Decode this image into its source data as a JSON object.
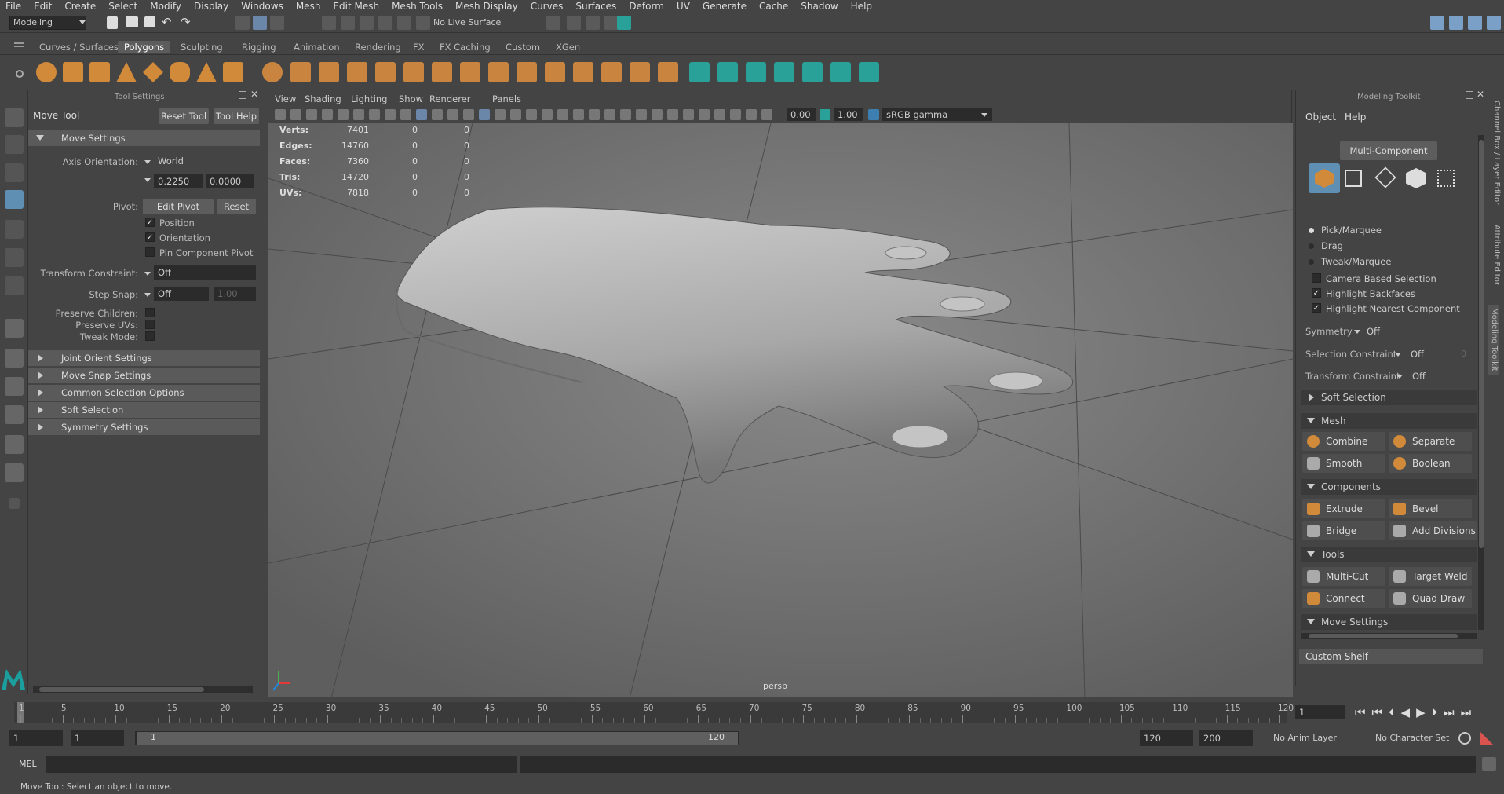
{
  "menubar": [
    "File",
    "Edit",
    "Create",
    "Select",
    "Modify",
    "Display",
    "Windows",
    "Mesh",
    "Edit Mesh",
    "Mesh Tools",
    "Mesh Display",
    "Curves",
    "Surfaces",
    "Deform",
    "UV",
    "Generate",
    "Cache",
    "Shadow",
    "Help"
  ],
  "status": {
    "menuset": "Modeling",
    "live_surface": "No Live Surface"
  },
  "shelf_tabs": [
    "Curves / Surfaces",
    "Polygons",
    "Sculpting",
    "Rigging",
    "Animation",
    "Rendering",
    "FX",
    "FX Caching",
    "Custom",
    "XGen"
  ],
  "shelf_active": "Polygons",
  "tool_settings": {
    "panel_title": "Tool Settings",
    "tool_name": "Move Tool",
    "reset_tool": "Reset Tool",
    "tool_help": "Tool Help",
    "section": "Move Settings",
    "axis_orientation_label": "Axis Orientation:",
    "axis_orientation": "World",
    "axis_val1": "0.2250",
    "axis_val2": "0.0000",
    "pivot_label": "Pivot:",
    "edit_pivot": "Edit Pivot",
    "reset": "Reset",
    "position": "Position",
    "orientation": "Orientation",
    "pin_component_pivot": "Pin Component Pivot",
    "transform_constraint_label": "Transform Constraint:",
    "transform_constraint": "Off",
    "step_snap_label": "Step Snap:",
    "step_snap": "Off",
    "step_snap_val": "1.00",
    "preserve_children": "Preserve Children:",
    "preserve_uvs": "Preserve UVs:",
    "tweak_mode": "Tweak Mode:",
    "collapsed_sections": [
      "Joint Orient Settings",
      "Move Snap Settings",
      "Common Selection Options",
      "Soft Selection",
      "Symmetry Settings"
    ]
  },
  "viewport": {
    "menus": [
      "View",
      "Shading",
      "Lighting",
      "Show",
      "Renderer",
      "Panels"
    ],
    "exposure": "0.00",
    "gamma": "1.00",
    "colorspace": "sRGB gamma",
    "camera": "persp",
    "hud": [
      {
        "label": "Verts:",
        "a": "7401",
        "b": "0",
        "c": "0"
      },
      {
        "label": "Edges:",
        "a": "14760",
        "b": "0",
        "c": "0"
      },
      {
        "label": "Faces:",
        "a": "7360",
        "b": "0",
        "c": "0"
      },
      {
        "label": "Tris:",
        "a": "14720",
        "b": "0",
        "c": "0"
      },
      {
        "label": "UVs:",
        "a": "7818",
        "b": "0",
        "c": "0"
      }
    ]
  },
  "modeling_toolkit": {
    "title": "Modeling Toolkit",
    "menus": [
      "Object",
      "Help"
    ],
    "mode": "Multi-Component",
    "selection_modes": [
      "Pick/Marquee",
      "Drag",
      "Tweak/Marquee"
    ],
    "options": [
      {
        "label": "Camera Based Selection",
        "checked": ""
      },
      {
        "label": "Highlight Backfaces",
        "checked": "✓"
      },
      {
        "label": "Highlight Nearest Component",
        "checked": "✓"
      }
    ],
    "symmetry_label": "Symmetry",
    "symmetry": "Off",
    "selection_constraint_label": "Selection Constraint",
    "selection_constraint": "Off",
    "selection_constraint_val": "0",
    "transform_constraint_label": "Transform Constraint",
    "transform_constraint": "Off",
    "soft_selection": "Soft Selection",
    "mesh_header": "Mesh",
    "combine": "Combine",
    "separate": "Separate",
    "smooth": "Smooth",
    "boolean": "Boolean",
    "components_header": "Components",
    "extrude": "Extrude",
    "bevel": "Bevel",
    "bridge": "Bridge",
    "add_divisions": "Add Divisions",
    "tools_header": "Tools",
    "multi_cut": "Multi-Cut",
    "target_weld": "Target Weld",
    "connect": "Connect",
    "quad_draw": "Quad Draw",
    "move_settings": "Move Settings",
    "custom_shelf": "Custom Shelf"
  },
  "side_tabs": [
    "Channel Box / Layer Editor",
    "Attribute Editor",
    "Modeling Toolkit"
  ],
  "timeline": {
    "ticks": [
      "1",
      "5",
      "10",
      "15",
      "20",
      "25",
      "30",
      "35",
      "40",
      "45",
      "50",
      "55",
      "60",
      "65",
      "70",
      "75",
      "80",
      "85",
      "90",
      "95",
      "100",
      "105",
      "110",
      "115",
      "120"
    ],
    "current_frame": "1",
    "range_start": "1",
    "range_start2": "1",
    "slider_start": "1",
    "slider_end": "120",
    "end1": "120",
    "end2": "200",
    "anim_layer": "No Anim Layer",
    "char_set": "No Character Set"
  },
  "cmd": {
    "label": "MEL"
  },
  "help_line": "Move Tool: Select an object to move."
}
